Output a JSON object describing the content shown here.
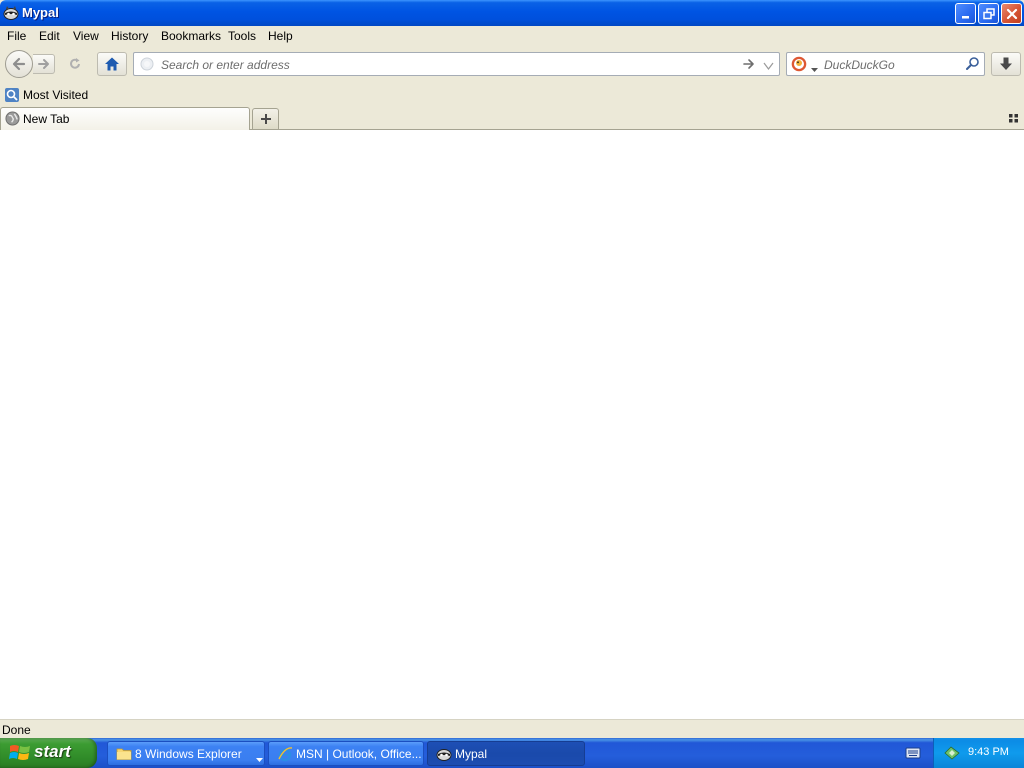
{
  "window": {
    "title": "Mypal",
    "app_icon": "mypal-raccoon-icon",
    "controls": [
      "minimize-icon",
      "restore-icon",
      "close-icon"
    ]
  },
  "menu": {
    "items": [
      {
        "label": "File"
      },
      {
        "label": "Edit"
      },
      {
        "label": "View"
      },
      {
        "label": "History"
      },
      {
        "label": "Bookmarks"
      },
      {
        "label": "Tools"
      },
      {
        "label": "Help"
      }
    ]
  },
  "navbar": {
    "back_icon": "back-arrow-icon",
    "forward_icon": "forward-arrow-icon",
    "reload_icon": "reload-icon",
    "home_icon": "home-icon",
    "url_placeholder": "Search or enter address",
    "url_value": "",
    "search_engine": "DuckDuckGo",
    "search_placeholder": "DuckDuckGo",
    "search_value": "",
    "download_icon": "download-icon"
  },
  "bookmarks": {
    "items": [
      {
        "label": "Most Visited",
        "icon": "most-visited-icon"
      }
    ]
  },
  "tabs": {
    "items": [
      {
        "label": "New Tab",
        "icon": "globe-icon",
        "active": true
      }
    ],
    "new_tab_icon": "plus-icon",
    "all_tabs_icon": "grid-icon"
  },
  "status": {
    "text": "Done"
  },
  "taskbar": {
    "start_label": "start",
    "tasks": [
      {
        "label": "8 Windows Explorer",
        "icon": "folder-icon"
      },
      {
        "label": "MSN | Outlook, Office...",
        "icon": "ie-icon"
      },
      {
        "label": "Mypal",
        "icon": "mypal-raccoon-icon",
        "active": true
      }
    ],
    "clock": "9:43 PM"
  },
  "colors": {
    "titlebar": "#0054e3",
    "taskbar": "#245edb",
    "start_button": "#3c9c32",
    "chrome": "#ece9d8",
    "content": "#ffffff"
  }
}
